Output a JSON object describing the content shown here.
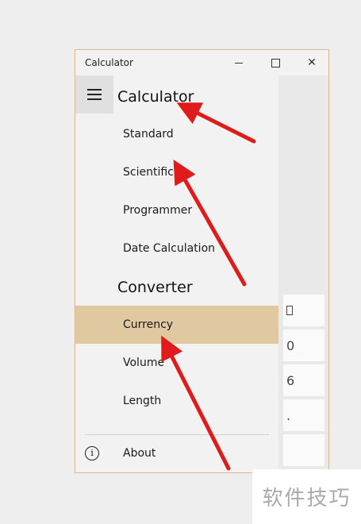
{
  "window": {
    "title": "Calculator",
    "controls": {
      "minimize": "minimize-icon",
      "maximize": "maximize-icon",
      "close": "✕"
    }
  },
  "nav": {
    "menu_icon": "hamburger-icon",
    "calculator_header": "Calculator",
    "calculator_items": [
      {
        "label": "Standard"
      },
      {
        "label": "Scientific"
      },
      {
        "label": "Programmer"
      },
      {
        "label": "Date Calculation"
      }
    ],
    "converter_header": "Converter",
    "converter_items": [
      {
        "label": "Currency",
        "selected": true
      },
      {
        "label": "Volume"
      },
      {
        "label": "Length"
      }
    ],
    "about_label": "About",
    "about_icon": "info-icon"
  },
  "calc_keys": [
    "0",
    "6",
    "0",
    "."
  ],
  "annotation_color": "#e01b1b",
  "selection_color": "#e0c9a1",
  "watermark": "软件技巧"
}
